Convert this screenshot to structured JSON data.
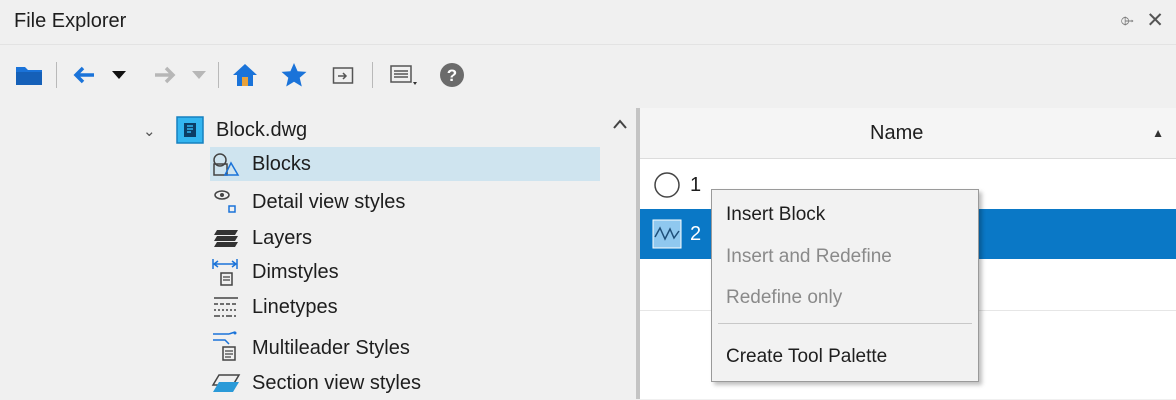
{
  "window": {
    "title": "File Explorer",
    "pin_glyph": "⌱",
    "close_glyph": "✕"
  },
  "toolbar": {
    "icons": [
      "open-folder-icon",
      "back-arrow-icon",
      "dropdown-icon",
      "forward-arrow-icon",
      "dropdown-icon",
      "home-icon",
      "favorites-star-icon",
      "browse-icon",
      "views-icon",
      "help-icon"
    ],
    "help_glyph": "?"
  },
  "tree": {
    "root": {
      "label": "Block.dwg",
      "expand_glyph": "⌄"
    },
    "items": [
      {
        "label": "Blocks",
        "icon": "blocks-icon",
        "selected": true
      },
      {
        "label": "Detail view styles",
        "icon": "detail-view-icon"
      },
      {
        "label": "Layers",
        "icon": "layers-icon"
      },
      {
        "label": "Dimstyles",
        "icon": "dimstyles-icon"
      },
      {
        "label": "Linetypes",
        "icon": "linetypes-icon"
      },
      {
        "label": "Multileader Styles",
        "icon": "multileader-icon"
      },
      {
        "label": "Section view styles",
        "icon": "section-view-icon"
      }
    ]
  },
  "list": {
    "column_header": "Name",
    "sort_glyph": "▲",
    "rows": [
      {
        "name": "1",
        "thumb": "circle-block-icon"
      },
      {
        "name": "2",
        "thumb": "wave-block-icon",
        "selected": true
      }
    ]
  },
  "context_menu": {
    "items": [
      {
        "label": "Insert Block",
        "enabled": true
      },
      {
        "label": "Insert and Redefine",
        "enabled": false
      },
      {
        "label": "Redefine only",
        "enabled": false
      },
      {
        "label": "Create Tool Palette",
        "enabled": true
      }
    ]
  },
  "colors": {
    "accent": "#0a78c6",
    "selection_light": "#cfe4ef",
    "icon_blue": "#1a73d9"
  }
}
